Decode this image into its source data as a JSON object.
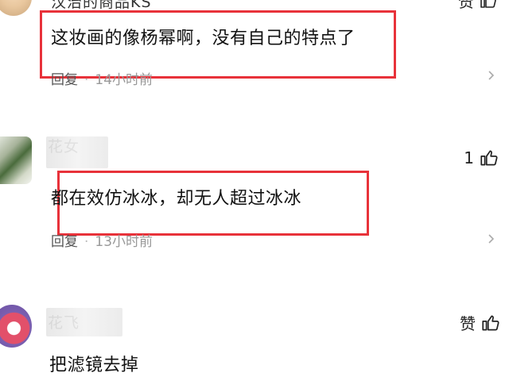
{
  "comments": [
    {
      "username": "汉治的商品KS",
      "text": "这妆画的像杨幂啊，没有自己的特点了",
      "reply_label": "回复",
      "time": "14小时前",
      "like_label": "赞",
      "like_count": ""
    },
    {
      "username": "花女",
      "text": "都在效仿冰冰，却无人超过冰冰",
      "reply_label": "回复",
      "time": "13小时前",
      "like_label": "",
      "like_count": "1"
    },
    {
      "username": "花飞",
      "text": "把滤镜去掉",
      "reply_label": "",
      "time": "",
      "like_label": "赞",
      "like_count": ""
    }
  ],
  "icons": {
    "like": "thumbs-up-icon",
    "more": "more-icon"
  },
  "colors": {
    "highlight": "#e8323a",
    "meta": "#999999"
  }
}
